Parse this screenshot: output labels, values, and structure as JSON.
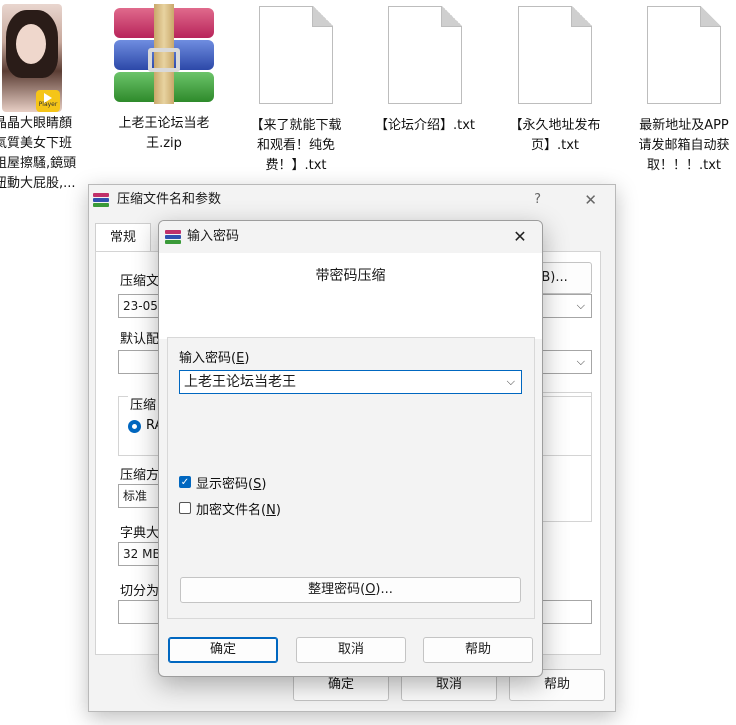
{
  "desktop": {
    "icons": [
      {
        "type": "video",
        "caption_lines": [
          "晶晶大眼睛顏",
          "氣質美女下班",
          "租屋擦騷,鏡頭",
          "扭動大屁股,..."
        ],
        "badge": "Player"
      },
      {
        "type": "zip",
        "caption_lines": [
          "上老王论坛当老",
          "王.zip"
        ]
      },
      {
        "type": "txt",
        "caption_lines": [
          "【来了就能下载",
          "和观看！纯免",
          "费！】.txt"
        ]
      },
      {
        "type": "txt",
        "caption_lines": [
          "【论坛介绍】.txt"
        ]
      },
      {
        "type": "txt",
        "caption_lines": [
          "【永久地址发布",
          "页】.txt"
        ]
      },
      {
        "type": "txt",
        "caption_lines": [
          "最新地址及APP",
          "请发邮箱自动获",
          "取！！！.txt"
        ]
      }
    ]
  },
  "back_dialog": {
    "title": "压缩文件名和参数",
    "help": "?",
    "close": "✕",
    "tab_general": "常规",
    "label_archive": "压缩文",
    "browse_button": "(B)...",
    "archive_value": "23-05",
    "label_profile": "默认配",
    "group_format_label": "压缩",
    "radio_rar": "RA",
    "label_method": "压缩方",
    "method_value": "标准",
    "label_dict": "字典大",
    "dict_value": "32 MB",
    "label_split": "切分为",
    "ok": "确定",
    "cancel": "取消",
    "help_button": "帮助"
  },
  "dialog": {
    "title": "输入密码",
    "close": "✕",
    "subtitle": "带密码压缩",
    "password_label": "输入密码",
    "password_label_key": "E",
    "password_value": "上老王论坛当老王",
    "show_password_label": "显示密码",
    "show_password_key": "S",
    "show_password_checked": true,
    "encrypt_names_label": "加密文件名",
    "encrypt_names_key": "N",
    "encrypt_names_checked": false,
    "organize_button_label": "整理密码",
    "organize_button_key": "O",
    "organize_button_suffix": "...",
    "ok": "确定",
    "cancel": "取消",
    "help": "帮助"
  },
  "colors": {
    "accent": "#0067c0",
    "dialog_bg": "#f3f3f3"
  }
}
